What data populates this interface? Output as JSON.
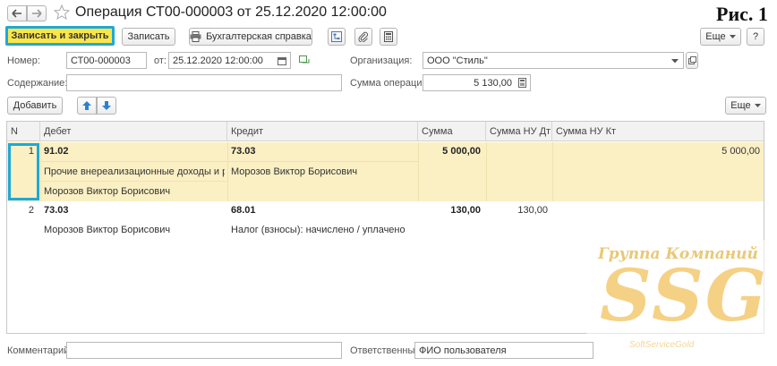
{
  "window": {
    "title": "Операция СТ00-000003 от 25.12.2020 12:00:00",
    "figure_label": "Рис. 1"
  },
  "toolbar": {
    "save_close_label": "Записать и закрыть",
    "save_label": "Записать",
    "accounting_label": "Бухгалтерская справка",
    "more_label": "Еще",
    "help_label": "?"
  },
  "form": {
    "number_label": "Номер:",
    "number_value": "СТ00-000003",
    "date_label": "от:",
    "date_value": "25.12.2020 12:00:00",
    "org_label": "Организация:",
    "org_value": "ООО \"Стиль\"",
    "content_label": "Содержание:",
    "content_value": "",
    "sum_label": "Сумма операции:",
    "sum_value": "5 130,00"
  },
  "table_toolbar": {
    "add_label": "Добавить",
    "more_label": "Еще"
  },
  "table": {
    "columns": [
      "N",
      "Дебет",
      "Кредит",
      "Сумма",
      "Сумма НУ Дт",
      "Сумма НУ Кт"
    ],
    "rows": [
      {
        "n": "1",
        "debit": "91.02",
        "debit_sub1": "Прочие внереализационные доходы и ра...",
        "debit_sub2": "Морозов Виктор Борисович",
        "credit": "73.03",
        "credit_sub1": "Морозов Виктор Борисович",
        "sum": "5 000,00",
        "nu_dt": "",
        "nu_kt": "5 000,00"
      },
      {
        "n": "2",
        "debit": "73.03",
        "debit_sub1": "Морозов Виктор Борисович",
        "credit": "68.01",
        "credit_sub1": "Налог (взносы): начислено / уплачено",
        "sum": "130,00",
        "nu_dt": "130,00",
        "nu_kt": ""
      }
    ]
  },
  "footer": {
    "comment_label": "Комментарий:",
    "comment_value": "",
    "responsible_label": "Ответственный:",
    "responsible_value": "ФИО пользователя"
  },
  "watermark": {
    "top": "Группа Компаний",
    "main": "SSG",
    "sub": "SoftServiceGold"
  },
  "colors": {
    "primary_button": "#fbe64a",
    "highlight_border": "#1ea9d6",
    "selected_row": "#fbf0c4"
  }
}
